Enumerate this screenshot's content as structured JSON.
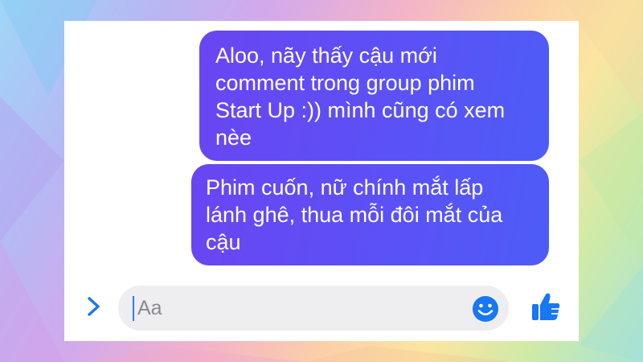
{
  "messages": [
    {
      "lines": [
        "Aloo, nãy thấy cậu mới",
        "comment trong group phim",
        "Start Up :)) mình cũng có xem",
        "nèe"
      ]
    },
    {
      "lines": [
        "Phim cuốn, nữ chính mắt lấp",
        "lánh ghê, thua mỗi đôi mắt của",
        "cậu"
      ]
    }
  ],
  "composer": {
    "placeholder": "Aa",
    "icons": [
      "chevron-right-icon",
      "emoji-icon",
      "thumbs-up-icon"
    ]
  },
  "colors": {
    "bubble": "#5a4ff5",
    "accent": "#1877f2",
    "input_bg": "#eeeef0"
  }
}
